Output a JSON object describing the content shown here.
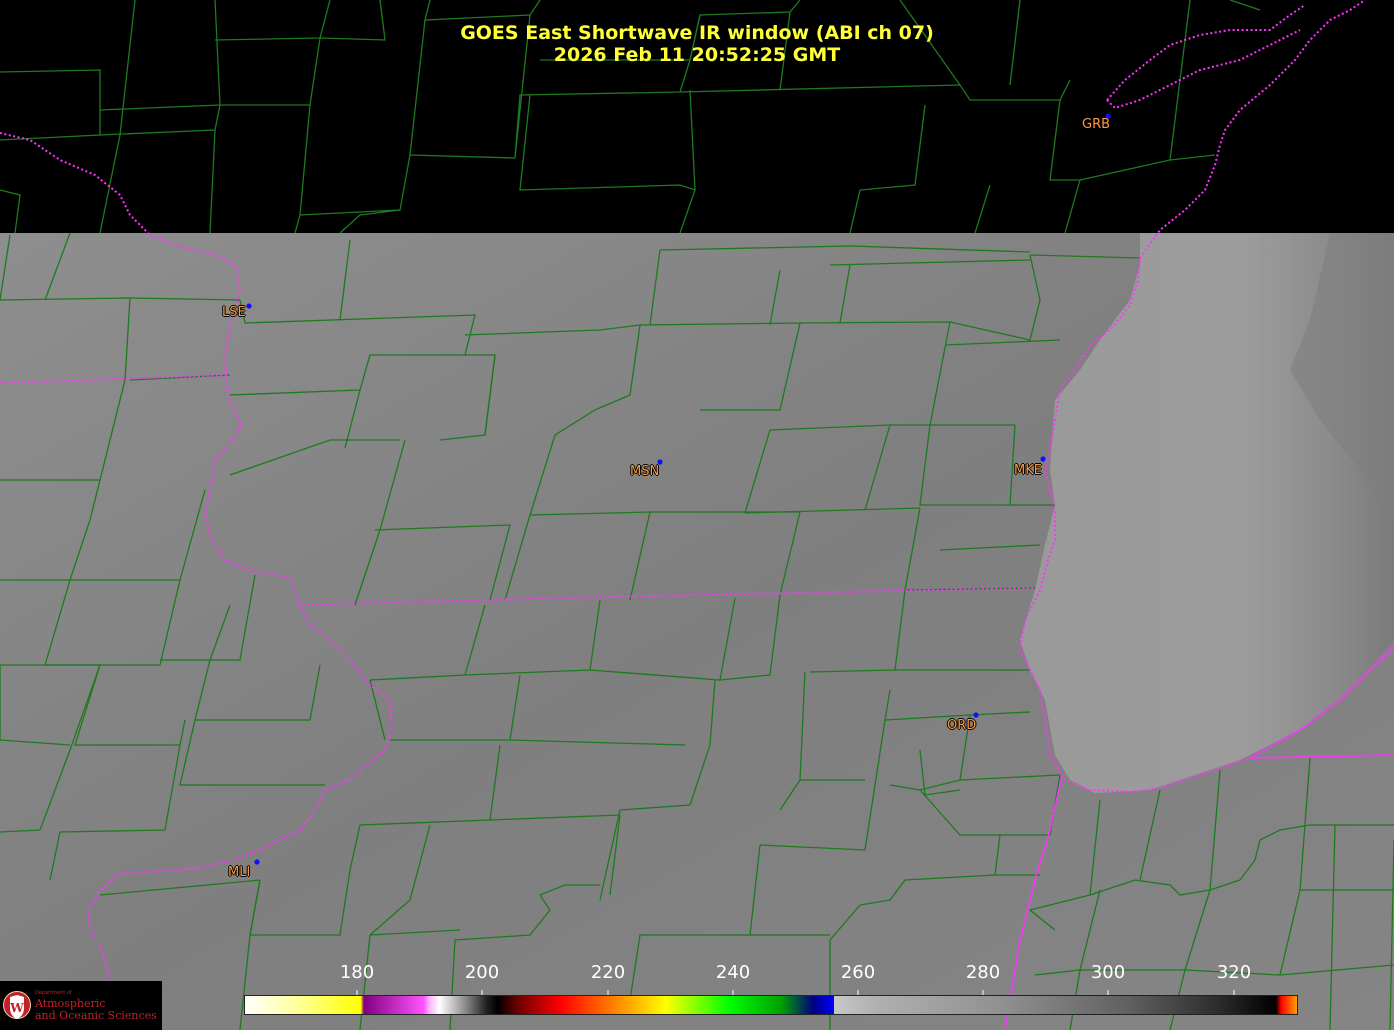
{
  "title": {
    "line1": "GOES East Shortwave IR window (ABI ch 07)",
    "line2": "2026 Feb 11  20:52:25 GMT"
  },
  "stations": [
    {
      "id": "grb",
      "label": "GRB"
    },
    {
      "id": "lse",
      "label": "LSE"
    },
    {
      "id": "msn",
      "label": "MSN"
    },
    {
      "id": "mke",
      "label": "MKE"
    },
    {
      "id": "ord",
      "label": "ORD"
    },
    {
      "id": "mli",
      "label": "MLI"
    }
  ],
  "colorbar": {
    "ticks": [
      "180",
      "200",
      "220",
      "240",
      "260",
      "280",
      "300",
      "320"
    ]
  },
  "logo": {
    "small_text": "Department of",
    "line1": "Atmospheric",
    "line2": "and Oceanic Sciences"
  },
  "colors": {
    "county_lines": "#1e7a1e",
    "state_lines": "#ff33ff",
    "title": "#ffff3a",
    "station_label": "#ff9a3a",
    "station_dot": "#1010ff"
  }
}
